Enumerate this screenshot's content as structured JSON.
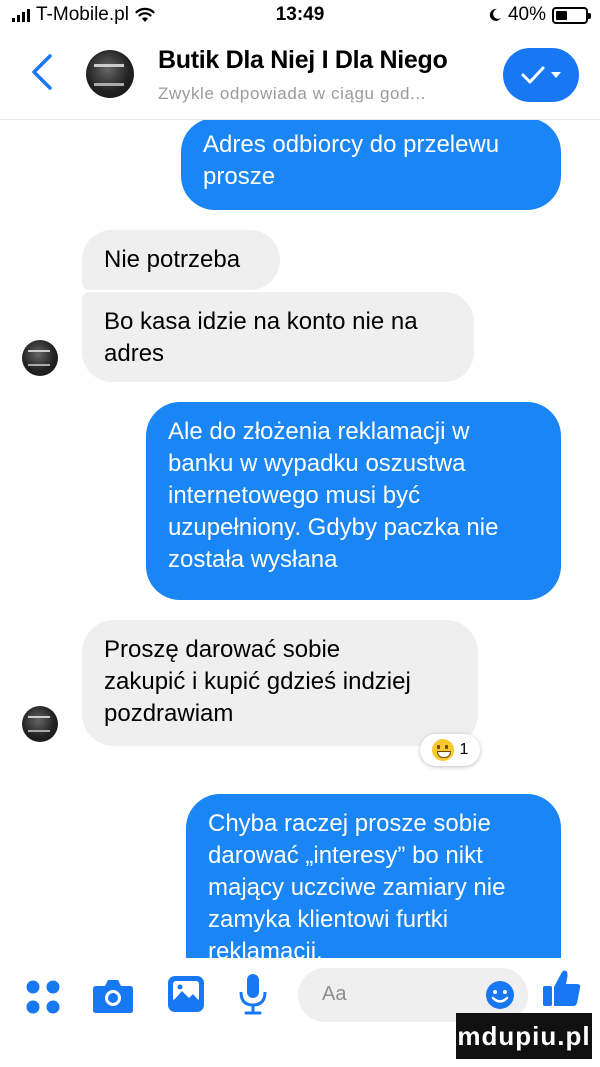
{
  "status_bar": {
    "carrier": "T-Mobile.pl",
    "time": "13:49",
    "battery": "40%",
    "battery_level": 0.4
  },
  "header": {
    "title": "Butik Dla Niej I Dla Niego",
    "subtitle": "Zwykle odpowiada w ciągu god...",
    "accent_color": "#1877f2"
  },
  "messages": [
    {
      "direction": "outgoing",
      "text": "Adres odbiorcy do przelewu\nprosze"
    },
    {
      "direction": "incoming",
      "text": "Nie potrzeba"
    },
    {
      "direction": "incoming",
      "text": "Bo kasa idzie na konto nie na\nadres"
    },
    {
      "direction": "outgoing",
      "text": "Ale do złożenia reklamacji w\nbanku w wypadku oszustwa\ninternetowego musi być\nuzupełniony. Gdyby paczka nie\nzostała wysłana"
    },
    {
      "direction": "incoming",
      "text": "Proszę darować sobie\nzakupić i kupić gdzieś indziej\npozdrawiam"
    },
    {
      "direction": "outgoing",
      "text": "Chyba raczej prosze sobie\ndarować „interesy” bo nikt\nmający uczciwe zamiary nie\nzamyka klientowi furtki\nreklamacji."
    }
  ],
  "reaction": {
    "icon": "grinning-face-emoji",
    "count": "1"
  },
  "composer": {
    "placeholder": "Aa",
    "icons": [
      "more-dots-icon",
      "camera-icon",
      "gallery-icon",
      "microphone-icon",
      "emoji-icon",
      "like-thumb-icon"
    ]
  },
  "colors": {
    "outgoing_bubble": "#1a85f5",
    "incoming_bubble": "#efefef"
  },
  "watermark": "mdupiu.pl"
}
